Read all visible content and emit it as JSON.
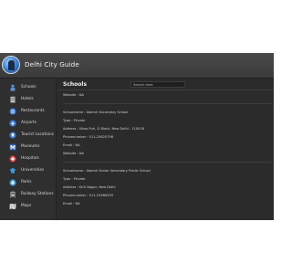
{
  "app": {
    "title": "Delhi City Guide"
  },
  "sidebar": {
    "items": [
      {
        "label": "Schools",
        "icon": "school-icon",
        "color": "#5b8fd6"
      },
      {
        "label": "Hotels",
        "icon": "hotel-icon",
        "color": "#c0c0c0"
      },
      {
        "label": "Restaurants",
        "icon": "restaurant-icon",
        "color": "#3a7bd5"
      },
      {
        "label": "Airports",
        "icon": "airport-icon",
        "color": "#3a7bd5"
      },
      {
        "label": "Tourist Locations",
        "icon": "tourist-location-icon",
        "color": "#3a7bd5"
      },
      {
        "label": "Museums",
        "icon": "museum-icon",
        "color": "#2b5fb0"
      },
      {
        "label": "Hospitals",
        "icon": "hospital-icon",
        "color": "#d93a3a"
      },
      {
        "label": "Universities",
        "icon": "university-icon",
        "color": "#3a9ad9"
      },
      {
        "label": "Parks",
        "icon": "park-icon",
        "color": "#3aa0d9"
      },
      {
        "label": "Railway Stations",
        "icon": "railway-station-icon",
        "color": "#c0c0c0"
      },
      {
        "label": "Maps",
        "icon": "map-icon",
        "color": "#d9d9d9"
      }
    ]
  },
  "main": {
    "section_title": "Schools",
    "search_placeholder": "Search here",
    "results": [
      {
        "lines": [
          "Website : NA"
        ]
      },
      {
        "lines": [
          "Schoolname : Adarsh Secondary School",
          "Type : Private",
          "Address : Vikas Puri, G Block, New Delhi - 110018",
          "Phonenumber : 011-25620798",
          "Email : NA",
          "Website : NA"
        ]
      },
      {
        "lines": [
          "Schoolname : Adarsh Senior Secondary Public School",
          "Type : Private",
          "Address : Kirti Nagar, New Delhi",
          "Phonenumber : 011-25466335",
          "Email : NA"
        ]
      }
    ]
  },
  "colors": {
    "background": "#2b2b2b",
    "sidebar": "#2f2f2f",
    "titlebar": "#3f3f3f",
    "text": "#cfcfcf"
  }
}
